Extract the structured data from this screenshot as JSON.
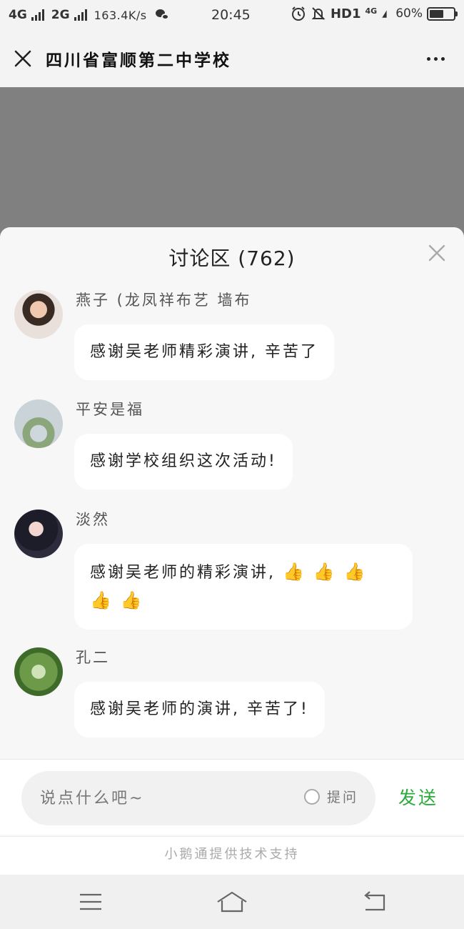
{
  "status_bar": {
    "network_1": "4G",
    "network_2": "2G",
    "speed": "163.4K/s",
    "time": "20:45",
    "hd_label": "HD1",
    "lte_label": "4G",
    "battery_percent": "60%",
    "battery_level": 0.6
  },
  "nav": {
    "title": "四川省富顺第二中学校",
    "close_icon": "close-icon",
    "more_icon": "more-dots-icon"
  },
  "discussion": {
    "title": "讨论区 (762)",
    "comments": [
      {
        "user": "燕子 (龙凤祥布艺 墙布",
        "text": "感谢吴老师精彩演讲, 辛苦了"
      },
      {
        "user": "平安是福",
        "text": "感谢学校组织这次活动!"
      },
      {
        "user": "淡然",
        "text": "感谢吴老师的精彩演讲,",
        "emoji": "👍"
      },
      {
        "user": "孔二",
        "text": "感谢吴老师的演讲, 辛苦了!"
      }
    ]
  },
  "composer": {
    "placeholder": "说点什么吧~",
    "ask_label": "提问",
    "send_label": "发送"
  },
  "footer": {
    "powered_by": "小鹅通提供技术支持"
  },
  "colors": {
    "accent_green": "#2aaa3a",
    "overlay_gray": "#808080",
    "panel_bg": "#f7f7f7"
  }
}
